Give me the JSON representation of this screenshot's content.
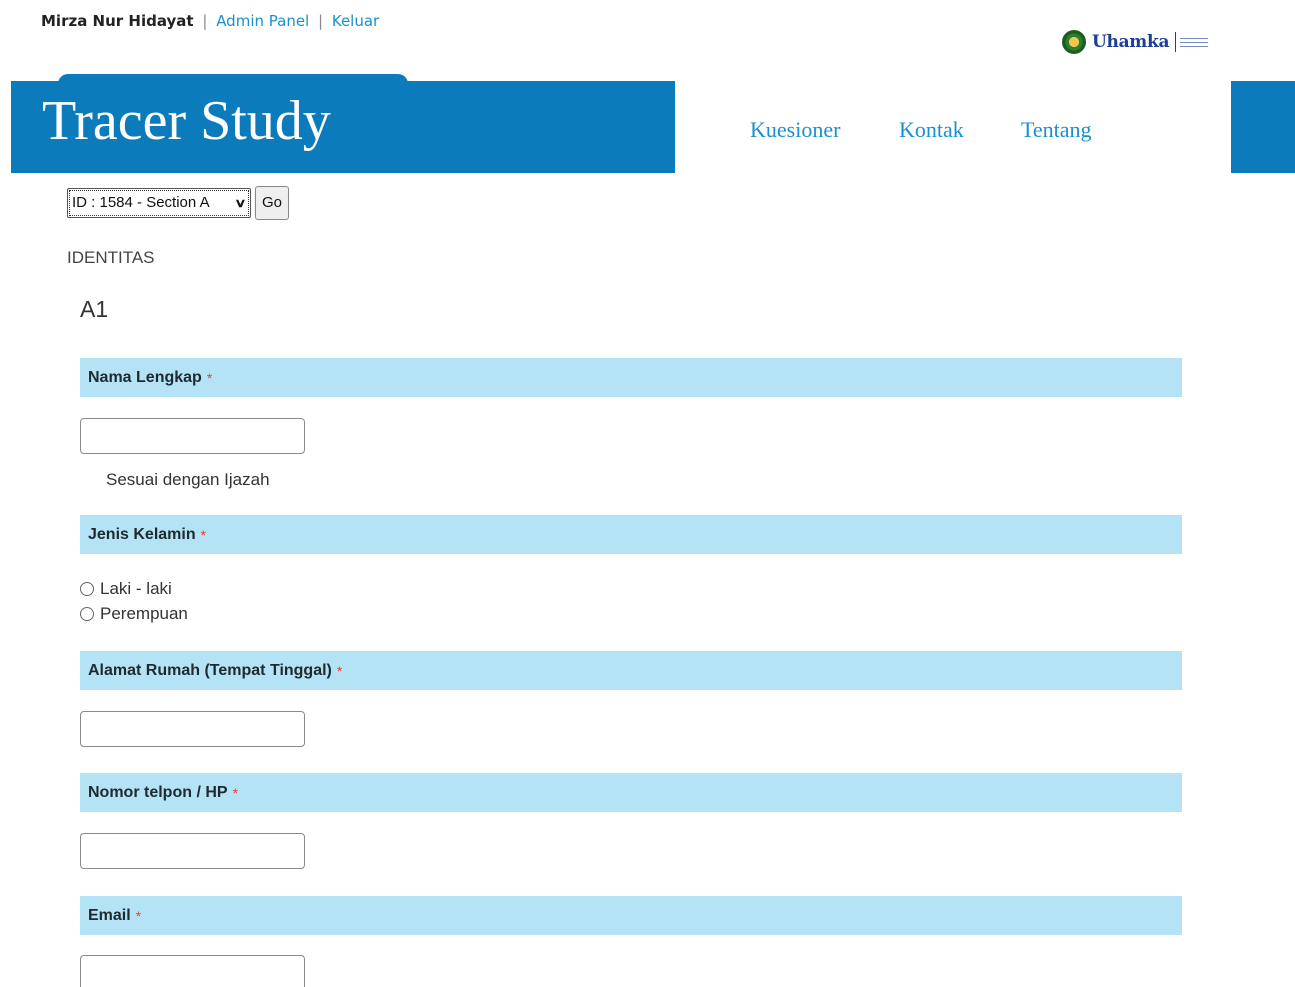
{
  "topbar": {
    "user": "Mirza Nur Hidayat",
    "sep": "|",
    "admin": "Admin Panel",
    "logout": "Keluar"
  },
  "logo": {
    "text": "Uhamka"
  },
  "header": {
    "title": "Tracer Study"
  },
  "nav": {
    "items": [
      "Kuesioner",
      "Kontak",
      "Tentang"
    ]
  },
  "section_select": {
    "value": "ID : 1584 - Section A",
    "go": "Go"
  },
  "section": {
    "name": "IDENTITAS",
    "code": "A1"
  },
  "required_mark": "*",
  "questions": {
    "nama": {
      "label": "Nama Lengkap",
      "hint": "Sesuai dengan Ijazah"
    },
    "jk": {
      "label": "Jenis Kelamin",
      "options": [
        "Laki - laki",
        "Perempuan"
      ]
    },
    "alamat": {
      "label": "Alamat Rumah (Tempat Tinggal)"
    },
    "telp": {
      "label": "Nomor telpon / HP"
    },
    "email": {
      "label": "Email"
    }
  },
  "colors": {
    "brand_blue": "#0b7bbb",
    "link": "#1a8fd0",
    "question_bg": "#b3e3f4",
    "required": "#e0413d"
  }
}
